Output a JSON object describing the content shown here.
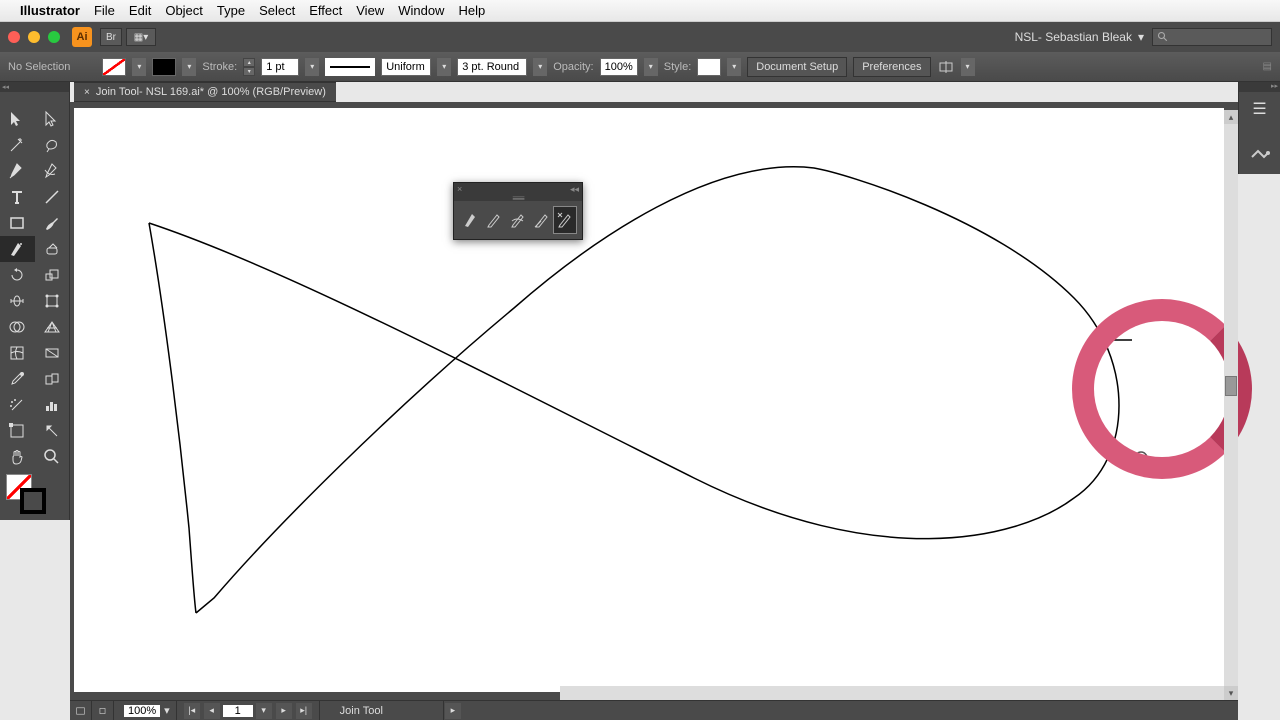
{
  "menubar": {
    "app": "Illustrator",
    "items": [
      "File",
      "Edit",
      "Object",
      "Type",
      "Select",
      "Effect",
      "View",
      "Window",
      "Help"
    ]
  },
  "titlebar": {
    "ai_label": "Ai",
    "profile": "NSL- Sebastian Bleak"
  },
  "controlbar": {
    "selection": "No Selection",
    "stroke_label": "Stroke:",
    "stroke_weight": "1 pt",
    "variable_width": "Uniform",
    "brush": "3 pt. Round",
    "opacity_label": "Opacity:",
    "opacity_value": "100%",
    "style_label": "Style:",
    "doc_setup": "Document Setup",
    "preferences": "Preferences"
  },
  "document": {
    "tab_title": "Join Tool- NSL 169.ai* @ 100% (RGB/Preview)"
  },
  "status": {
    "zoom": "100%",
    "page": "1",
    "tool": "Join Tool"
  },
  "tool_panel_icons": [
    "selection",
    "direct-selection",
    "magic-wand",
    "lasso",
    "pen",
    "curvature",
    "type",
    "line-segment",
    "rectangle",
    "paintbrush",
    "shaper",
    "eraser",
    "rotate",
    "scale",
    "width",
    "free-transform",
    "shape-builder",
    "perspective-grid",
    "mesh",
    "gradient",
    "eyedropper",
    "blend",
    "symbol-sprayer",
    "column-graph",
    "artboard",
    "slice",
    "hand",
    "zoom"
  ],
  "float_panel_tools": [
    "shaper",
    "pencil",
    "smooth",
    "path-eraser",
    "join"
  ],
  "colors": {
    "annotation_ring": "#d85a7a",
    "annotation_ring_dark": "#b83a5a"
  }
}
